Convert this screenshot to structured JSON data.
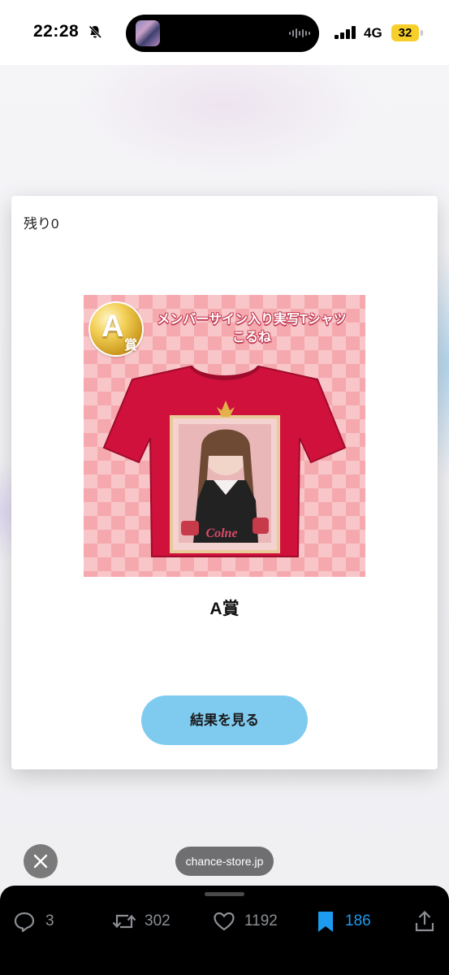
{
  "status_bar": {
    "time": "22:28",
    "network": "4G",
    "battery": "32"
  },
  "modal": {
    "remaining": "残り0",
    "prize_image": {
      "medal_letter": "A",
      "medal_sub": "賞",
      "title_line1": "メンバーサイン入り実写Tシャツ",
      "title_line2": "こるね",
      "signature": "Colne"
    },
    "prize_name": "A賞",
    "result_button": "結果を見る"
  },
  "overlay": {
    "domain": "chance-store.jp"
  },
  "actions": {
    "replies": "3",
    "reposts": "302",
    "likes": "1192",
    "bookmarks": "186"
  },
  "colors": {
    "accent_blue": "#1d9bf0",
    "button_blue": "#7fcbf0",
    "battery_yellow": "#f7cf2b",
    "shirt_red": "#d0113c"
  },
  "icons": [
    "bell-slash-icon",
    "signal-icon",
    "close-icon",
    "reply-icon",
    "repost-icon",
    "like-icon",
    "bookmark-icon",
    "share-icon"
  ]
}
